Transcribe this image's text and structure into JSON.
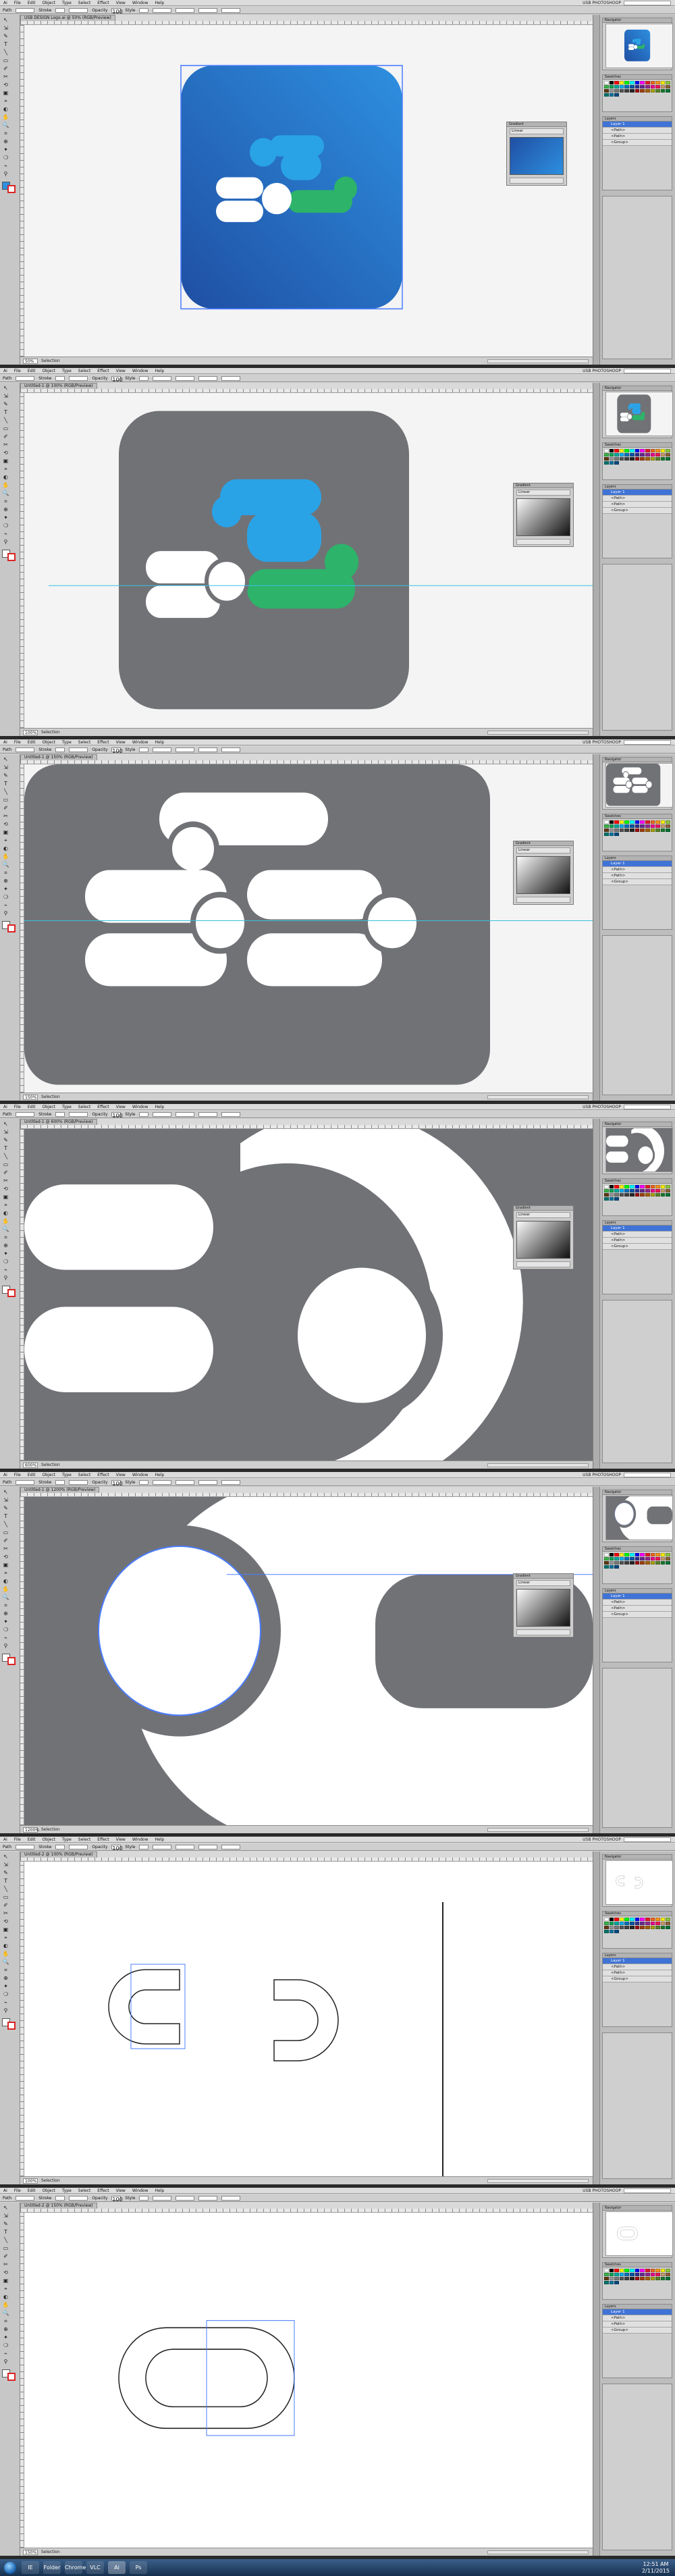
{
  "app": {
    "workspace_label": "USB PHOTOSHOOP",
    "menu": [
      "Ai",
      "File",
      "Edit",
      "Object",
      "Type",
      "Select",
      "Effect",
      "View",
      "Window",
      "Help"
    ]
  },
  "control_bar": {
    "selection_label": "Path",
    "stroke_label": "Stroke",
    "opacity_label": "Opacity",
    "opacity_value": "100",
    "style_label": "Style"
  },
  "panels": [
    {
      "tab": "USB DESIGN Logo.ai @ 50% (RGB/Preview)",
      "zoom": "50%",
      "status": "Selection",
      "state": "logo-full",
      "float": true
    },
    {
      "tab": "Untitled-1 @ 100% (RGB/Preview)",
      "zoom": "100%",
      "status": "Selection",
      "state": "gray-logo",
      "float": true
    },
    {
      "tab": "Untitled-1 @ 150% (RGB/Preview)",
      "zoom": "150%",
      "status": "Selection",
      "state": "gray-zoom",
      "float": true
    },
    {
      "tab": "Untitled-1 @ 600% (RGB/Preview)",
      "zoom": "600%",
      "status": "Selection",
      "state": "gray-macro",
      "float": true
    },
    {
      "tab": "Untitled-1 @ 1200% (RGB/Preview)",
      "zoom": "1200%",
      "status": "Selection",
      "state": "circle-macro",
      "float": true
    },
    {
      "tab": "Untitled-2 @ 100% (RGB/Preview)",
      "zoom": "100%",
      "status": "Selection",
      "state": "u-outline",
      "float": false
    },
    {
      "tab": "Untitled-2 @ 150% (RGB/Preview)",
      "zoom": "150%",
      "status": "Selection",
      "state": "pill-outline",
      "float": false
    }
  ],
  "dock": {
    "navigator_label": "Navigator",
    "swatches_label": "Swatches",
    "layers_label": "Layers",
    "layer_names": [
      "Layer 1",
      "<Path>",
      "<Path>",
      "<Group>"
    ],
    "gradient_label": "Gradient",
    "gradient_type": "Linear"
  },
  "taskbar": {
    "time": "12:51 AM",
    "date": "2/11/2015",
    "apps": [
      "IE",
      "Folder",
      "Chrome",
      "VLC",
      "Ai",
      "Ps"
    ]
  },
  "colors": {
    "logo_blue_dark": "#1f4fa3",
    "logo_blue_light": "#2e8fe0",
    "accent_cyan": "#2aa3e6",
    "accent_green": "#2db36a",
    "artboard_gray": "#717276",
    "selection_blue": "#4a7cff"
  }
}
